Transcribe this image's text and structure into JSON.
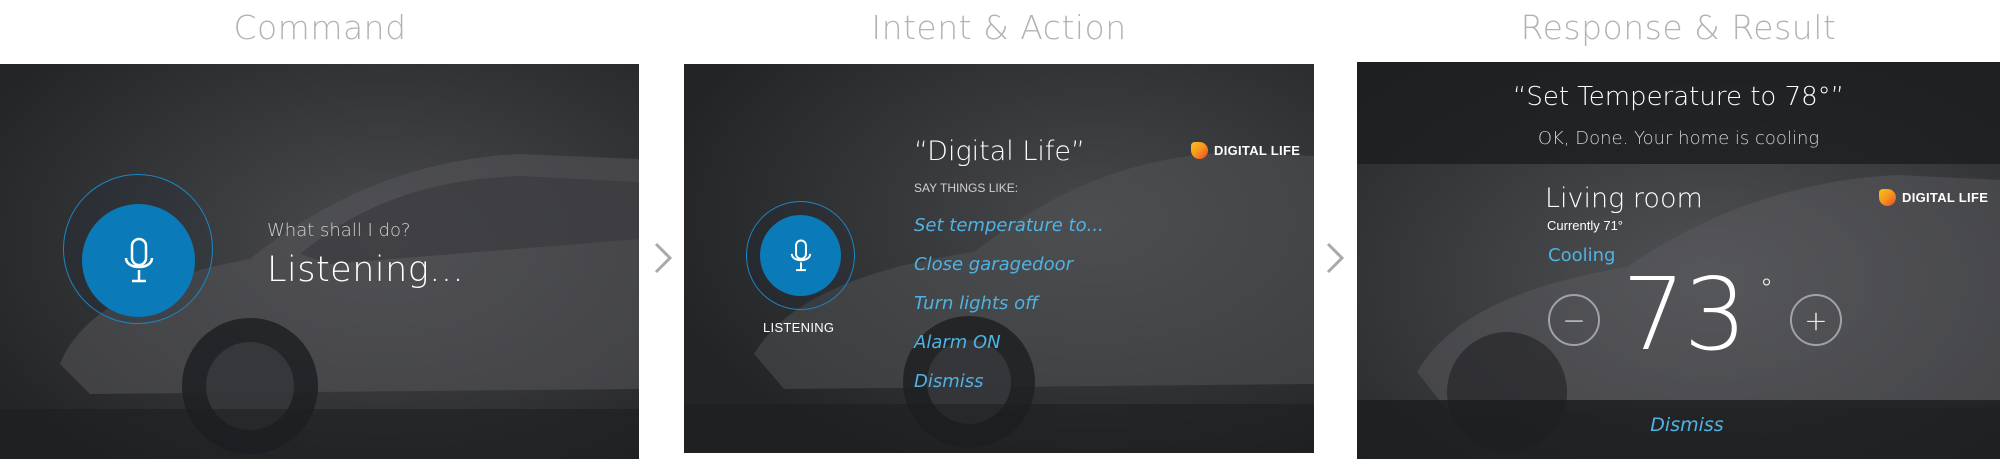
{
  "steps": {
    "command_title": "Command",
    "intent_title": "Intent & Action",
    "response_title": "Response & Result"
  },
  "panel1": {
    "prompt": "What shall I do?",
    "status": "Listening..."
  },
  "panel2": {
    "heading": "“Digital Life”",
    "say_things_like": "SAY THINGS LIKE:",
    "suggestions": [
      "Set temperature to...",
      "Close garagedoor",
      "Turn lights off",
      "Alarm ON",
      "Dismiss"
    ],
    "listening_label": "LISTENING",
    "logo_text": "DIGITAL LIFE"
  },
  "panel3": {
    "command_echo": "“Set Temperature to 78°”",
    "confirmation": "OK, Done. Your home is cooling",
    "room": "Living room",
    "current": "Currently 71°",
    "mode": "Cooling",
    "setpoint": "73",
    "degree": "°",
    "minus": "−",
    "plus": "+",
    "dismiss": "Dismiss",
    "logo_text": "DIGITAL LIFE"
  },
  "icons": {
    "mic": "microphone-icon",
    "arrow": "chevron-right-icon",
    "logo": "digital-life-logo-icon"
  },
  "colors": {
    "accent_blue": "#0a7ab8",
    "link_blue": "#4fb3e3",
    "panel_bg": "#2e2f31",
    "title_grey": "#b3b3b3"
  }
}
